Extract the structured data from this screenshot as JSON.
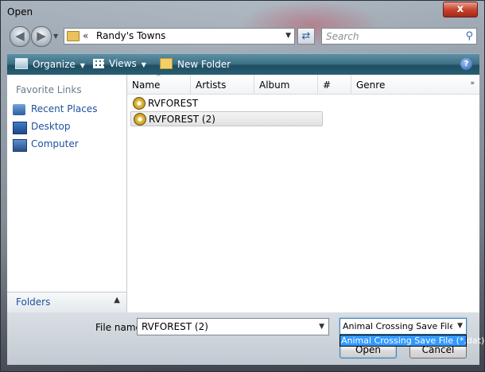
{
  "window": {
    "title": "Open",
    "close_glyph": "x"
  },
  "nav": {
    "back_icon": "back-arrow-icon",
    "forward_icon": "forward-arrow-icon",
    "address_chevron": "«",
    "address_path": "Randy's Towns",
    "search_placeholder": "Search"
  },
  "toolbar": {
    "organize": "Organize",
    "views": "Views",
    "new_folder": "New Folder",
    "help": "?"
  },
  "sidebar": {
    "title": "Favorite Links",
    "items": [
      {
        "label": "Recent Places",
        "icon": "recent-places-icon"
      },
      {
        "label": "Desktop",
        "icon": "desktop-icon"
      },
      {
        "label": "Computer",
        "icon": "computer-icon"
      }
    ],
    "folders_label": "Folders"
  },
  "filelist": {
    "columns": [
      "Name",
      "Artists",
      "Album",
      "#",
      "Genre"
    ],
    "files": [
      {
        "name": "RVFOREST",
        "selected": false
      },
      {
        "name": "RVFOREST (2)",
        "selected": true
      }
    ]
  },
  "bottom": {
    "file_name_label": "File name:",
    "file_name_value": "RVFOREST (2)",
    "file_type_value": "Animal Crossing Save File (*.d",
    "file_type_option": "Animal Crossing Save File (*.dat)",
    "open_label": "Open",
    "cancel_label": "Cancel"
  }
}
